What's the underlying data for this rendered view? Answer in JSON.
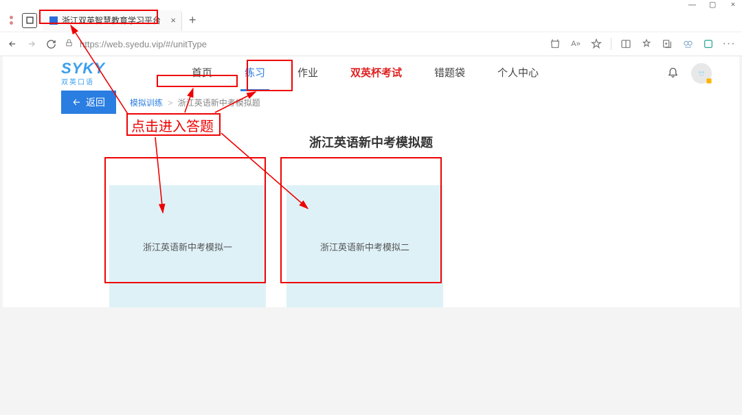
{
  "window": {
    "min": "—",
    "max": "▢",
    "close": "×"
  },
  "tab": {
    "title": "浙江双英智慧教育学习平台"
  },
  "url": {
    "text": "https://web.syedu.vip/#/unitType"
  },
  "logo": {
    "main": "SYKY",
    "sub": "双英口语"
  },
  "menu": {
    "items": [
      {
        "label": "首页"
      },
      {
        "label": "练习"
      },
      {
        "label": "作业"
      },
      {
        "label": "双英杯考试"
      },
      {
        "label": "错题袋"
      },
      {
        "label": "个人中心"
      }
    ]
  },
  "back_label": "返回",
  "breadcrumb": {
    "a": "模拟训练",
    "b": "浙江英语新中考模拟题",
    "sep": ">"
  },
  "page_title": "浙江英语新中考模拟题",
  "cards": [
    {
      "label": "浙江英语新中考模拟一"
    },
    {
      "label": "浙江英语新中考模拟二"
    }
  ],
  "annotation": {
    "text": "点击进入答题"
  }
}
